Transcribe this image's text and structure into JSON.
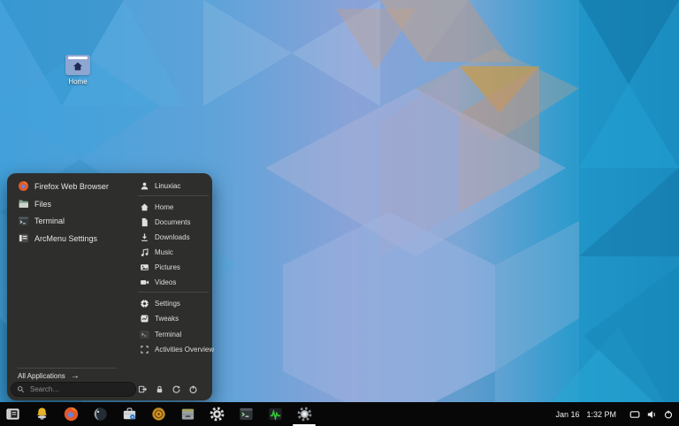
{
  "desktop": {
    "home_icon": {
      "label": "Home"
    }
  },
  "menu": {
    "pinned_apps": [
      {
        "label": "Firefox Web Browser",
        "icon": "firefox-icon"
      },
      {
        "label": "Files",
        "icon": "files-folder-icon"
      },
      {
        "label": "Terminal",
        "icon": "terminal-icon"
      },
      {
        "label": "ArcMenu Settings",
        "icon": "arcmenu-settings-icon"
      }
    ],
    "user": {
      "name": "Linuxiac",
      "icon": "user-icon"
    },
    "places": [
      {
        "label": "Home",
        "icon": "home-icon"
      },
      {
        "label": "Documents",
        "icon": "document-icon"
      },
      {
        "label": "Downloads",
        "icon": "download-icon"
      },
      {
        "label": "Music",
        "icon": "music-note-icon"
      },
      {
        "label": "Pictures",
        "icon": "picture-icon"
      },
      {
        "label": "Videos",
        "icon": "video-camera-icon"
      }
    ],
    "shortcuts": [
      {
        "label": "Settings",
        "icon": "settings-gear-icon"
      },
      {
        "label": "Tweaks",
        "icon": "tweaks-icon"
      },
      {
        "label": "Terminal",
        "icon": "terminal-icon"
      },
      {
        "label": "Activities Overview",
        "icon": "activities-overview-icon"
      }
    ],
    "all_applications": {
      "label": "All Applications",
      "arrow": "→"
    },
    "search": {
      "placeholder": "Search…",
      "icon": "search-icon"
    },
    "session_buttons": [
      {
        "icon": "log-out-icon"
      },
      {
        "icon": "lock-icon"
      },
      {
        "icon": "restart-icon"
      },
      {
        "icon": "power-off-icon"
      }
    ]
  },
  "taskbar": {
    "apps": [
      {
        "icon": "arcmenu-launcher-icon"
      },
      {
        "icon": "bell-app-icon"
      },
      {
        "icon": "firefox-app-icon"
      },
      {
        "icon": "globe-app-icon"
      },
      {
        "icon": "briefcase-lock-app-icon"
      },
      {
        "icon": "coin-app-icon"
      },
      {
        "icon": "archive-drawer-app-icon"
      },
      {
        "icon": "settings-gear-app-icon"
      },
      {
        "icon": "terminal-app-icon"
      },
      {
        "icon": "system-monitor-app-icon"
      },
      {
        "icon": "gear-app-icon",
        "running": true
      }
    ],
    "clock": {
      "date": "Jan 16",
      "time": "1:32 PM"
    },
    "tray": [
      {
        "icon": "display-icon"
      },
      {
        "icon": "volume-icon"
      },
      {
        "icon": "power-icon"
      }
    ]
  },
  "theme": {
    "panel_bg": "#2e2e2c",
    "taskbar_bg": "#070707",
    "separator": "#474747",
    "wallpaper_left": "#42a0da",
    "wallpaper_mid": "#8aa3d8",
    "wallpaper_right": "#1e84b6",
    "wallpaper_accent": "#d09a3e"
  }
}
